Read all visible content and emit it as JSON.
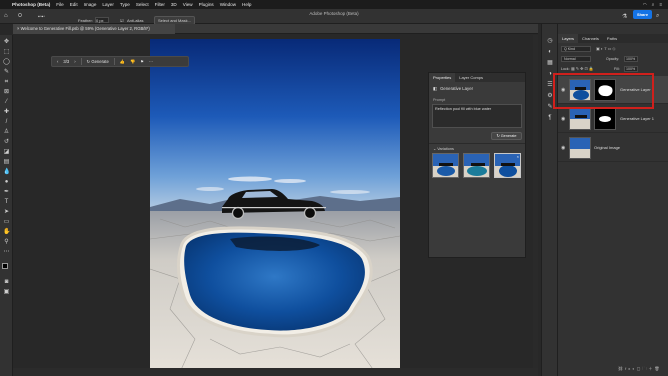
{
  "menubar": {
    "app": "Photoshop (Beta)",
    "items": [
      "File",
      "Edit",
      "Image",
      "Layer",
      "Type",
      "Select",
      "Filter",
      "3D",
      "View",
      "Plugins",
      "Window",
      "Help"
    ]
  },
  "window": {
    "title": "Adobe Photoshop (Beta)"
  },
  "options": {
    "feather_label": "Feather:",
    "feather_value": "0 px",
    "antialias_label": "Anti-alias",
    "select_mask_label": "Select and Mask..."
  },
  "document_tab": {
    "label": "Welcome to Generative Fill.psb @ 59% (Generative Layer 2, RGB/8*)"
  },
  "context_bar": {
    "page_indicator": "3/3",
    "generate_label": "Generate"
  },
  "properties": {
    "tabs": [
      "Properties",
      "Layer Comps"
    ],
    "active_tab": "Properties",
    "section_title": "Generative Layer",
    "prompt_label": "Prompt",
    "prompt_value": "Reflection pool fill with blue water",
    "generate_label": "Generate",
    "variations_label": "Variations"
  },
  "share": {
    "label": "Share"
  },
  "layers_panel": {
    "tabs": [
      "Layers",
      "Channels",
      "Paths"
    ],
    "active_tab": "Layers",
    "kind_label": "Q Kind",
    "mode_label": "Normal",
    "opacity_label": "Opacity:",
    "opacity_value": "100%",
    "lock_label": "Lock:",
    "fill_label": "Fill:",
    "fill_value": "100%",
    "layers": [
      {
        "name": "Generative Layer 2",
        "selected": true
      },
      {
        "name": "Generative Layer 1",
        "selected": false
      },
      {
        "name": "Original Image",
        "selected": false
      }
    ]
  },
  "colors": {
    "accent": "#1473e6",
    "highlight": "#d0201c"
  }
}
